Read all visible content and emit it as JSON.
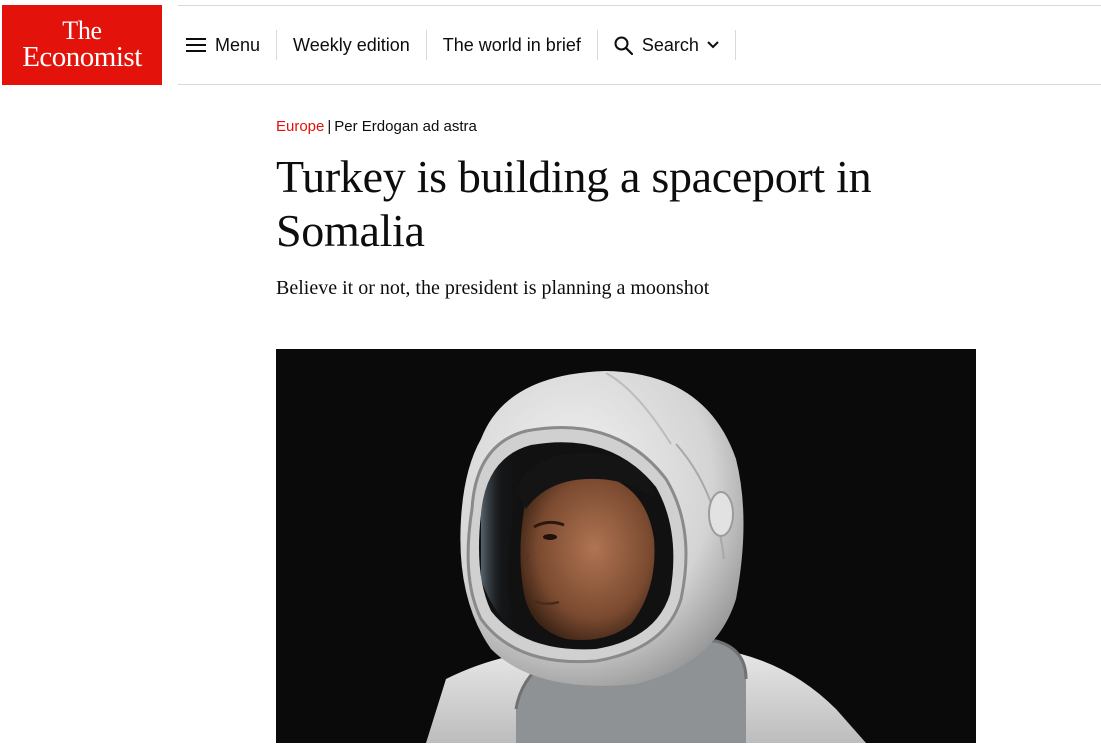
{
  "brand": {
    "line1": "The",
    "line2": "Economist",
    "color": "#e3120b"
  },
  "nav": {
    "menu": {
      "icon": "hamburger-icon",
      "label": "Menu"
    },
    "weekly_edition": "Weekly edition",
    "world_in_brief": "The world in brief",
    "search": {
      "icon": "search-icon",
      "label": "Search",
      "chevron": "chevron-down-icon"
    }
  },
  "article": {
    "section": "Europe",
    "separator": "|",
    "rubric": "Per Erdogan ad astra",
    "headline": "Turkey is building a spaceport in Somalia",
    "standfirst": "Believe it or not, the president is planning a moonshot"
  },
  "colors": {
    "accent": "#e3120b",
    "text": "#0d0d0d",
    "rule": "#d9d9d9",
    "image_bg": "#0a0a0a"
  }
}
